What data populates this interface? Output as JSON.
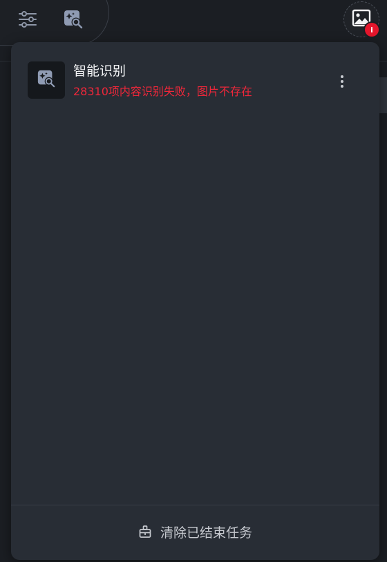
{
  "toolbar": {
    "filter_icon": "sliders-icon",
    "recognition_icon": "image-search-sparkle-icon",
    "task_icon": "image-icon",
    "task_badge": "i"
  },
  "task_panel": {
    "items": [
      {
        "icon": "image-search-sparkle-icon",
        "title": "智能识别",
        "status": "28310项内容识别失败，图片不存在",
        "status_color": "#f0273a"
      }
    ],
    "clear_button": {
      "icon": "broom-icon",
      "label": "清除已结束任务"
    }
  },
  "colors": {
    "background": "#1b1e23",
    "panel": "#282d35",
    "error": "#e5162c",
    "icon_accent": "#8f9bb3"
  }
}
